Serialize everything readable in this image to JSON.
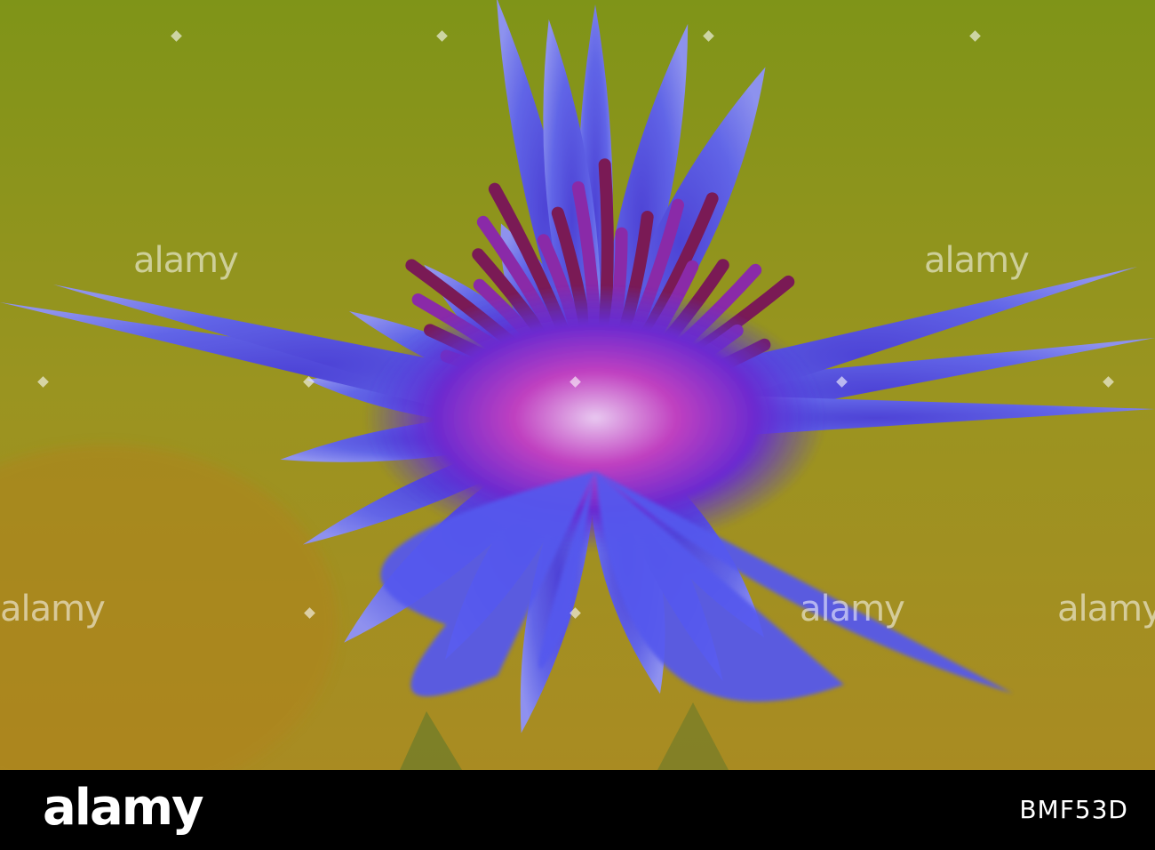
{
  "photo": {
    "subject": "blue-cornflower-icon",
    "colors": {
      "background_top": "#8a9a1e",
      "background_bottom": "#b08a1c",
      "petal": "#5a5cf0",
      "petal_light": "#8f8ff8",
      "center": "#7a1fb0",
      "stamen": "#6a1a4a",
      "accent": "#e0208a"
    }
  },
  "watermarks": [
    "alamy",
    "alamy",
    "alamy",
    "alamy",
    "alamy"
  ],
  "footer": {
    "brand": "alamy",
    "image_id": "BMF53D"
  }
}
